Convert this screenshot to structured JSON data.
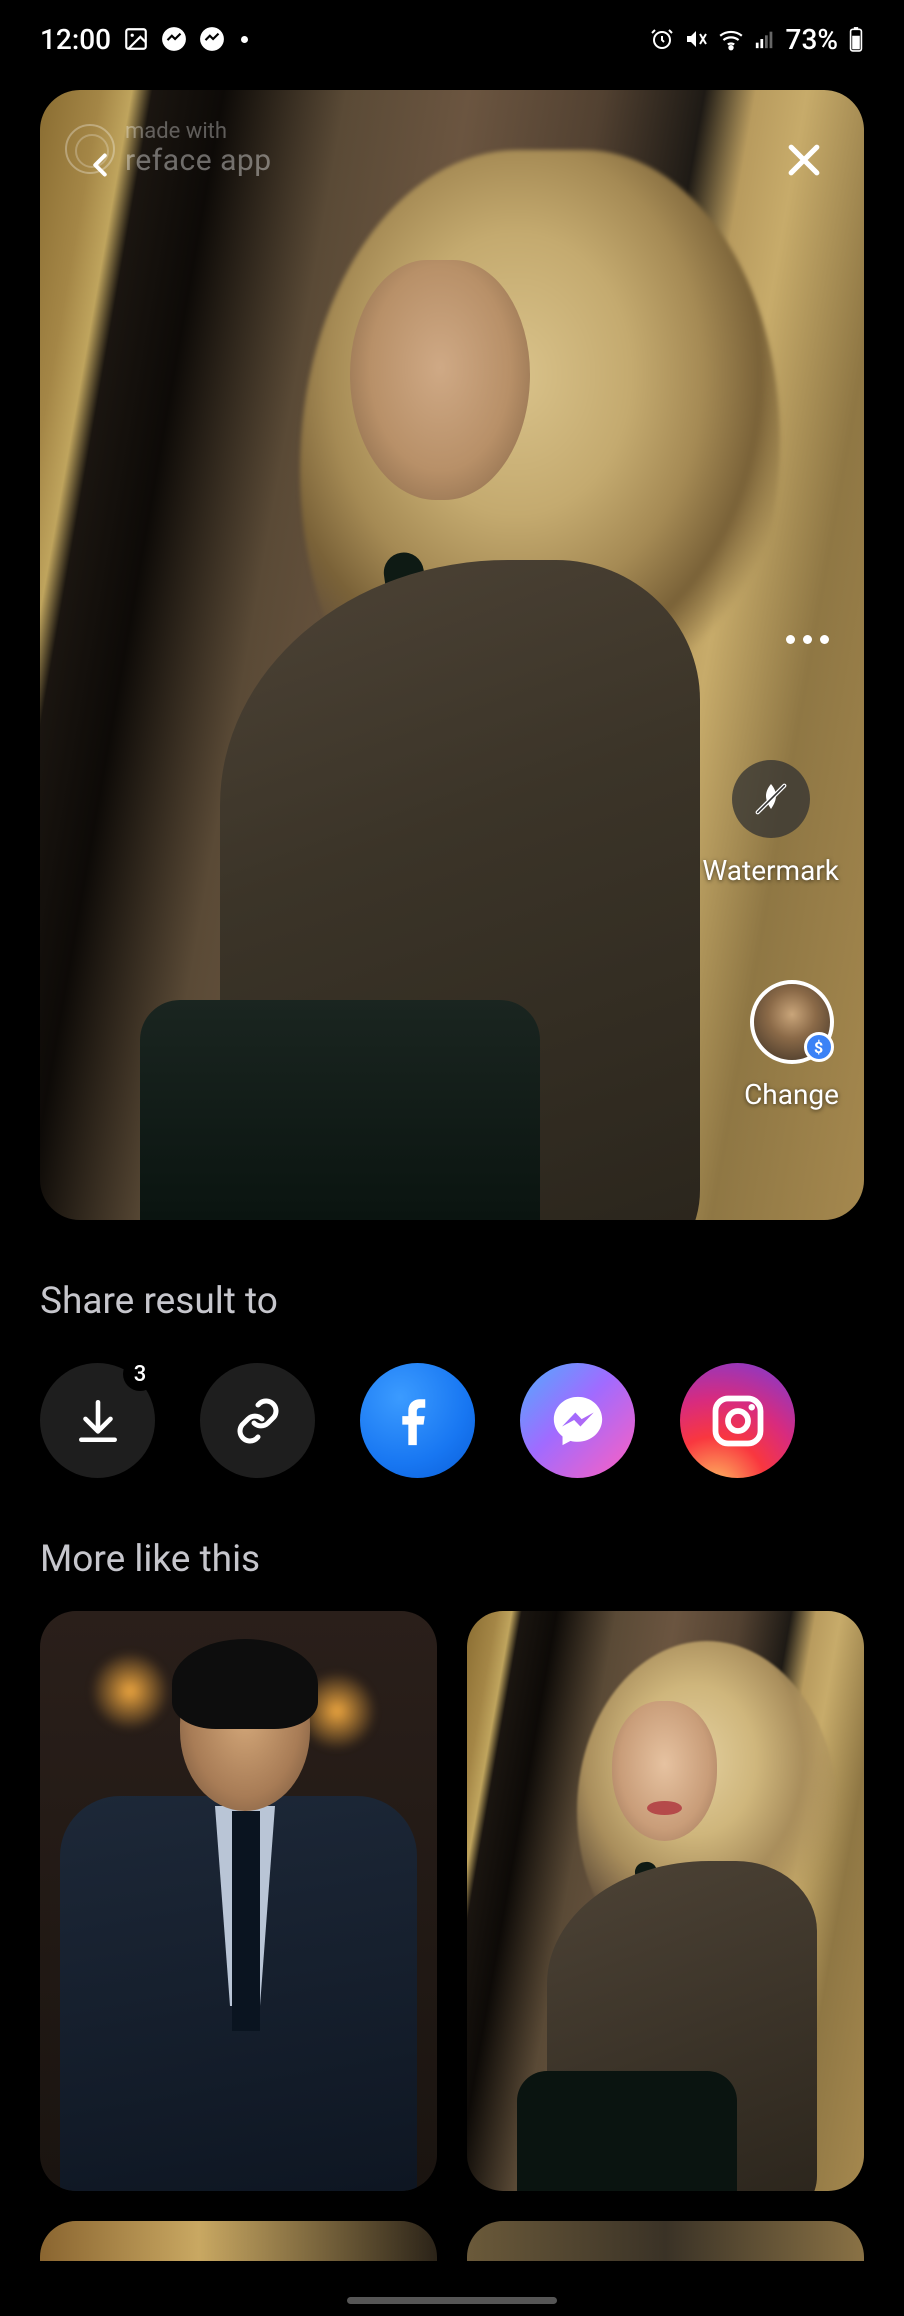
{
  "status": {
    "time": "12:00",
    "battery": "73%"
  },
  "watermark_badge": {
    "line1": "made with",
    "line2": "reface app"
  },
  "controls": {
    "watermark_label": "Watermark",
    "change_label": "Change",
    "change_badge": "$"
  },
  "share": {
    "title": "Share result to",
    "download_badge": "3"
  },
  "more": {
    "title": "More like this"
  }
}
